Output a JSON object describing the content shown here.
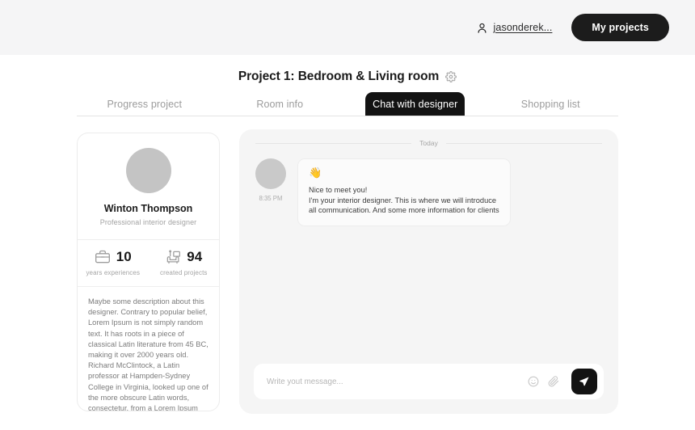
{
  "header": {
    "account_icon": "user-icon",
    "account_name": "jasonderek...",
    "my_projects_label": "My projects",
    "background_color": "#f5f5f6",
    "button_color": "#1c1c1c"
  },
  "title": {
    "text": "Project 1: Bedroom & Living room",
    "settings_icon": "gear-icon"
  },
  "tabs": [
    {
      "label": "Progress project",
      "active": false
    },
    {
      "label": "Room info",
      "active": false
    },
    {
      "label": "Chat with designer",
      "active": true
    },
    {
      "label": "Shopping list",
      "active": false
    }
  ],
  "designer": {
    "avatar": "avatar-placeholder",
    "name": "Winton Thompson",
    "role": "Professional interior designer",
    "stats": [
      {
        "icon": "briefcase-icon",
        "value": "10",
        "label": "years experiences"
      },
      {
        "icon": "sofa-icon",
        "value": "94",
        "label": "created projects"
      }
    ],
    "description": "Maybe some description about this designer. Contrary to popular belief, Lorem Ipsum is not simply random text. It has roots in a piece of classical Latin literature from 45 BC, making it over 2000 years old. Richard McClintock, a Latin professor at Hampden-Sydney College in Virginia, looked up one of the more obscure Latin words, consectetur, from a Lorem Ipsum passage"
  },
  "chat": {
    "day_divider": "Today",
    "messages": [
      {
        "avatar": "avatar-placeholder",
        "time": "8:35 PM",
        "emoji": "👋",
        "line1": "Nice to meet you!",
        "line2": "I'm your interior designer. This is where we will introduce",
        "line3": "all communication. And some more information for clients"
      }
    ],
    "composer": {
      "placeholder": "Write yout message...",
      "value": "",
      "emoji_icon": "emoji-smiley-icon",
      "attach_icon": "paperclip-icon",
      "send_icon": "send-paper-plane-icon",
      "send_button_color": "#131313"
    },
    "panel_color": "#f5f5f5"
  }
}
